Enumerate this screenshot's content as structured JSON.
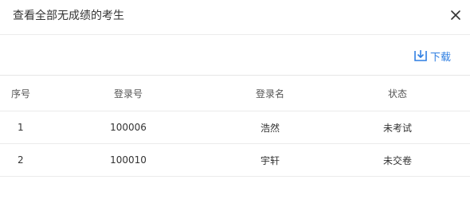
{
  "dialog": {
    "title": "查看全部无成绩的考生"
  },
  "toolbar": {
    "download_label": "下载"
  },
  "colors": {
    "accent": "#2f7fe2",
    "status_red": "#d9322c"
  },
  "table": {
    "columns": [
      "序号",
      "登录号",
      "登录名",
      "状态"
    ],
    "rows": [
      {
        "seq": "1",
        "login_id": "100006",
        "login_name": "浩然",
        "status": "未考试"
      },
      {
        "seq": "2",
        "login_id": "100010",
        "login_name": "宇轩",
        "status": "未交卷"
      }
    ]
  }
}
